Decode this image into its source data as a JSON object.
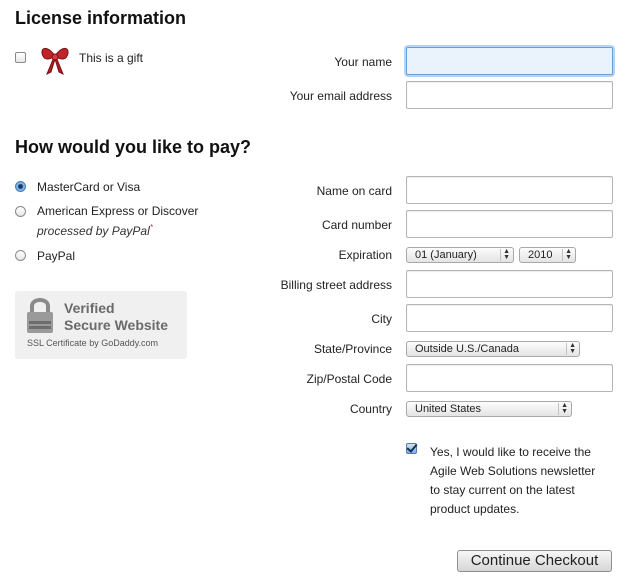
{
  "license": {
    "heading": "License information",
    "gift_label": "This is a gift",
    "your_name_label": "Your name",
    "your_name_value": "",
    "email_label": "Your email address",
    "email_value": ""
  },
  "payment": {
    "heading": "How would you like to pay?",
    "methods": [
      {
        "label": "MasterCard or Visa",
        "selected": true
      },
      {
        "label": "American Express or Discover",
        "sublabel": "processed by PayPal",
        "selected": false
      },
      {
        "label": "PayPal",
        "selected": false
      }
    ],
    "name_on_card_label": "Name on card",
    "card_number_label": "Card number",
    "expiration_label": "Expiration",
    "expiration_month": "01 (January)",
    "expiration_year": "2010",
    "billing_street_label": "Billing street address",
    "city_label": "City",
    "state_label": "State/Province",
    "state_value": "Outside U.S./Canada",
    "zip_label": "Zip/Postal Code",
    "country_label": "Country",
    "country_value": "United States",
    "newsletter_lines": [
      "Yes, I would like to receive the",
      "Agile Web Solutions newsletter",
      "to stay current on the latest",
      "product updates."
    ],
    "newsletter_checked": true,
    "continue_label": "Continue Checkout"
  },
  "badge": {
    "title_line1": "Verified",
    "title_line2": "Secure Website",
    "caption": "SSL Certificate by GoDaddy.com",
    "icon": "padlock-icon"
  },
  "colors": {
    "focus_border": "#6a9fd6",
    "focus_fill": "#eaf2fc",
    "gift_bow": "#c0242a"
  }
}
